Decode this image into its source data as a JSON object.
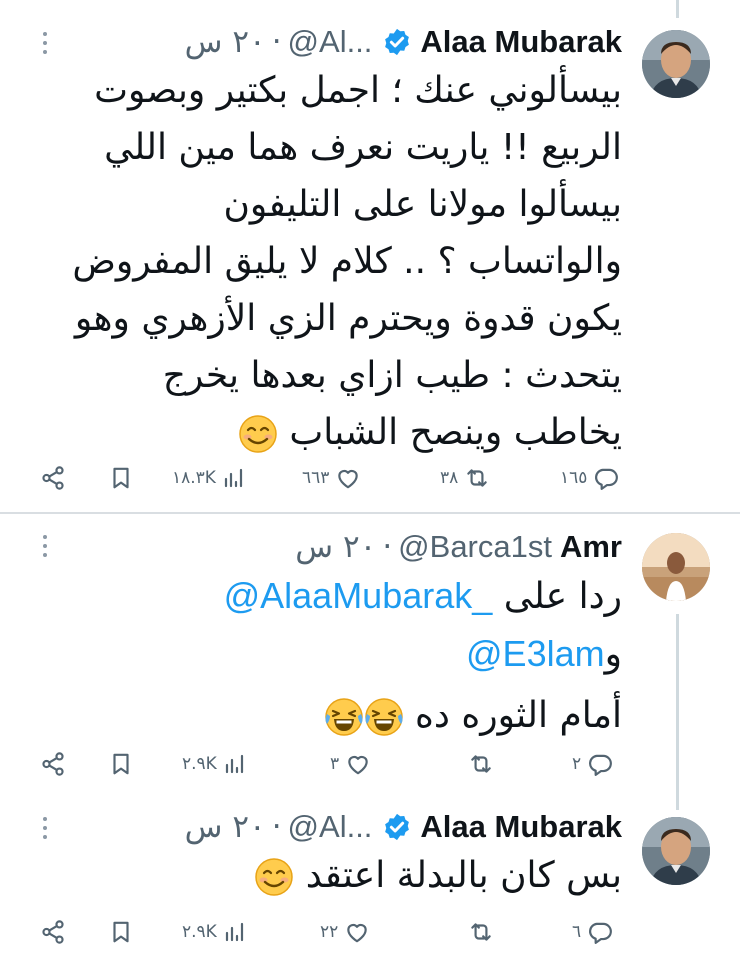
{
  "tweets": [
    {
      "name": "Alaa Mubarak",
      "verified": true,
      "handle": "@Al...",
      "time": "٢٠ س",
      "lines": [
        "بيسألوني عنك ؛ اجمل بكتير وبصوت",
        "الربيع !! ياريت نعرف هما مين اللي",
        "بيسألوا مولانا على التليفون",
        "والواتساب ؟ .. كلام لا يليق المفروض",
        "يكون قدوة ويحترم الزي الأزهري وهو",
        "يتحدث : طيب ازاي بعدها يخرج",
        "يخاطب وينصح الشباب"
      ],
      "emoji": [
        "smiling-face-icon"
      ],
      "stats": {
        "replies": "١٦٥",
        "retweets": "٣٨",
        "likes": "٦٦٣",
        "views": "١٨.٣K"
      }
    },
    {
      "name": "Amr",
      "verified": false,
      "handle": "@Barca1st",
      "time": "٢٠ س",
      "reply_prefix": "ردا على",
      "mention1": "@AlaaMubarak_",
      "mention2_prefix": "و",
      "mention2": "@E3lam",
      "line": "أمام الثوره ده",
      "emoji": [
        "laughing-tears-icon",
        "laughing-tears-icon"
      ],
      "stats": {
        "replies": "٢",
        "retweets": "",
        "likes": "٣",
        "views": "٢.٩K"
      }
    },
    {
      "name": "Alaa Mubarak",
      "verified": true,
      "handle": "@Al...",
      "time": "٢٠ س",
      "line": "بس كان بالبدلة اعتقد",
      "emoji": [
        "smiling-face-icon"
      ],
      "stats": {
        "replies": "٦",
        "retweets": "",
        "likes": "٢٢",
        "views": "٢.٩K"
      }
    }
  ],
  "colors": {
    "text": "#0f1419",
    "secondary": "#536471",
    "link": "#1d9bf0",
    "verified": "#1d9bf0",
    "divider": "#d9dee2"
  }
}
